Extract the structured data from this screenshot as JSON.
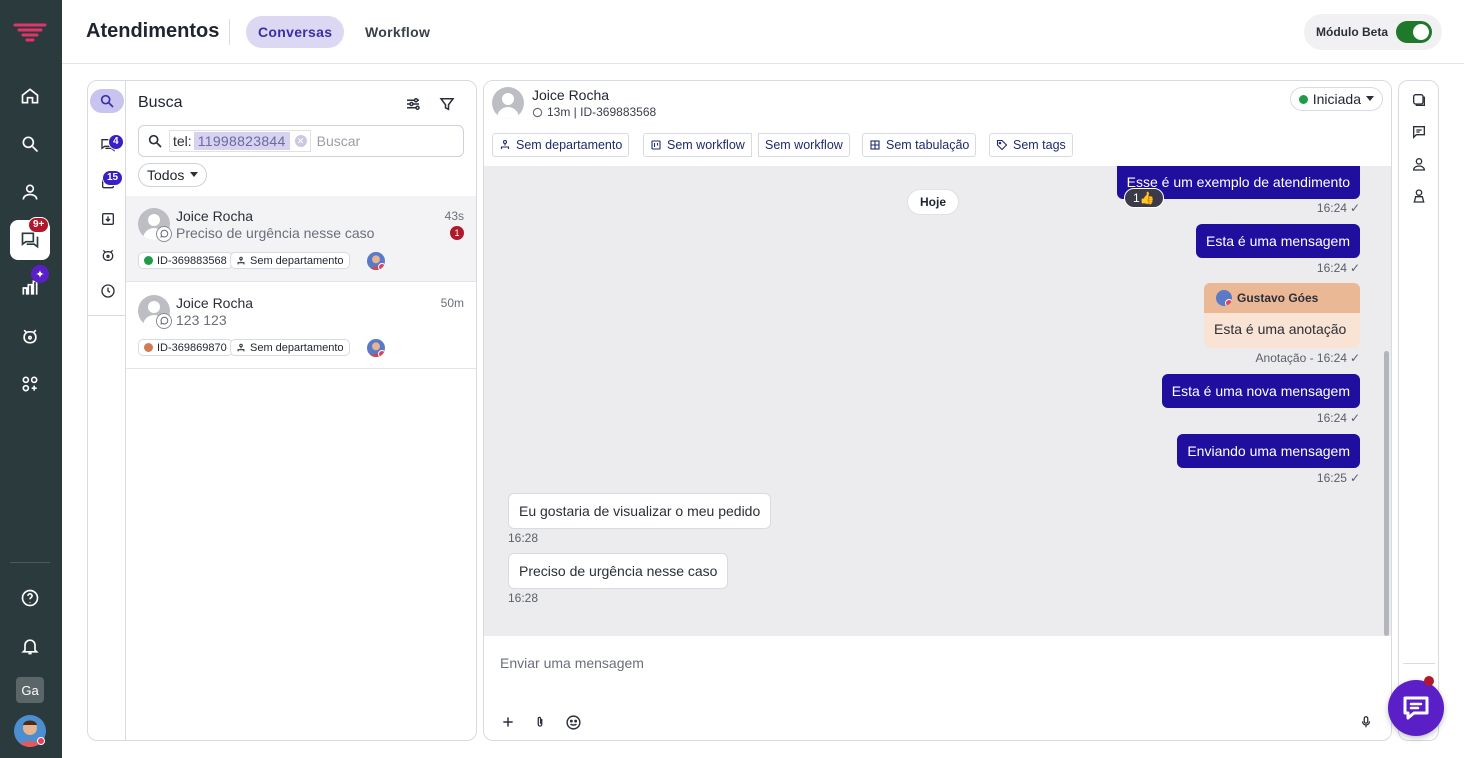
{
  "app": {
    "title": "Atendimentos",
    "tabs": [
      "Conversas",
      "Workflow"
    ],
    "beta_label": "Módulo Beta"
  },
  "rail": {
    "chat_badge": "9+",
    "user_initials": "Ga"
  },
  "list": {
    "search_label": "Busca",
    "inbox_badge": "4",
    "queue_badge": "15",
    "chip_prefix": "tel:",
    "chip_value": "11998823844",
    "search_placeholder": "Buscar",
    "filter_value": "Todos",
    "conversations": [
      {
        "name": "Joice Rocha",
        "last_message": "Preciso de urgência nesse caso",
        "time": "43s",
        "unread": "1",
        "id": "ID-369883568",
        "status_color": "#1e9c48",
        "department": "Sem departamento"
      },
      {
        "name": "Joice Rocha",
        "last_message": "123 123",
        "time": "50m",
        "unread": "",
        "id": "ID-369869870",
        "status_color": "#d27a52",
        "department": "Sem departamento"
      }
    ]
  },
  "chat": {
    "contact_name": "Joice Rocha",
    "contact_sub": "13m | ID-369883568",
    "status": "Iniciada",
    "status_color": "#1e9c48",
    "tags": {
      "department": "Sem departamento",
      "workflow_a": "Sem workflow",
      "workflow_b": "Sem workflow",
      "tabulation": "Sem tabulação",
      "tags": "Sem tags"
    },
    "day_separator": "Hoje",
    "messages": [
      {
        "text": "Esse é um exemplo de atendimento",
        "meta": "16:24",
        "reaction": "1👍"
      },
      {
        "text": "Esta é uma mensagem",
        "meta": "16:24"
      },
      {
        "author": "Gustavo Góes",
        "text": "Esta é uma anotação",
        "meta": "Anotação - 16:24"
      },
      {
        "text": "Esta é uma nova mensagem",
        "meta": "16:24"
      },
      {
        "text": "Enviando uma mensagem",
        "meta": "16:25"
      },
      {
        "text": "Eu gostaria de visualizar o meu pedido",
        "meta": "16:28"
      },
      {
        "text": "Preciso de urgência nesse caso",
        "meta": "16:28"
      }
    ],
    "input_placeholder": "Enviar uma mensagem"
  }
}
